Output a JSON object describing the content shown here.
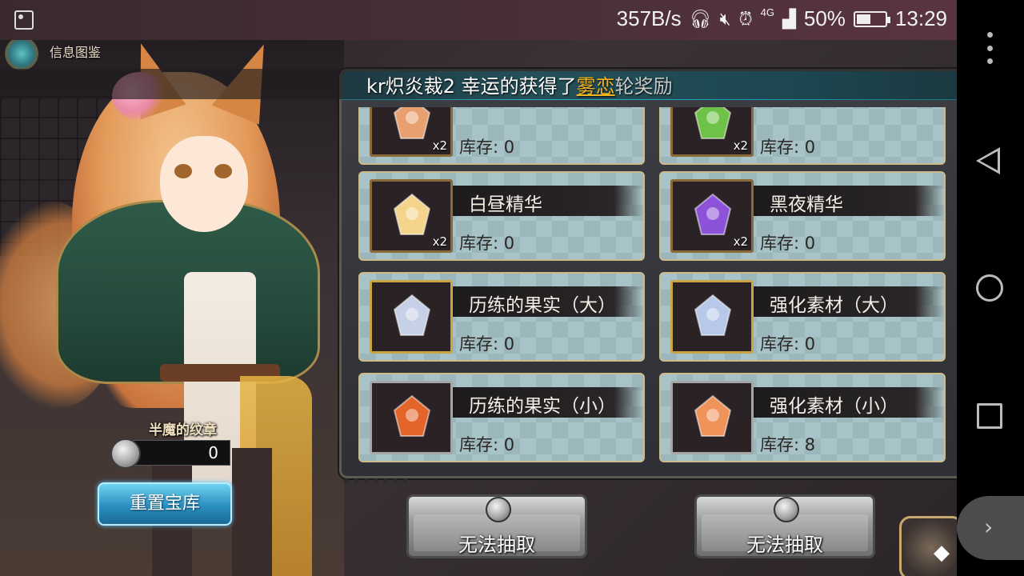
{
  "status_bar": {
    "speed": "357B/s",
    "network": "4G",
    "battery": "50%",
    "battery_level": 0.5,
    "time": "13:29",
    "icons": [
      "image-icon",
      "headphones-icon",
      "mute-icon",
      "alarm-icon",
      "signal-icon",
      "battery-icon"
    ]
  },
  "game": {
    "info_tab": "信息图鉴",
    "ticker": {
      "prefix": "kr炽炎裁2 幸运的获得了",
      "highlight": "雾恋",
      "suffix": "轮奖励"
    },
    "items": [
      {
        "name": "",
        "stock": "库存: 0",
        "multiplier": "x2",
        "icon": "orange-crystal-icon",
        "color": "#e8a070",
        "frame": "bronze"
      },
      {
        "name": "",
        "stock": "库存: 0",
        "multiplier": "x2",
        "icon": "green-thorn-icon",
        "color": "#6ec248",
        "frame": "bronze"
      },
      {
        "name": "白昼精华",
        "stock": "库存: 0",
        "multiplier": "x2",
        "icon": "day-essence-icon",
        "color": "#f3d48a",
        "frame": "bronze"
      },
      {
        "name": "黑夜精华",
        "stock": "库存: 0",
        "multiplier": "x2",
        "icon": "night-essence-icon",
        "color": "#8c52d8",
        "frame": "bronze"
      },
      {
        "name": "历练的果实（大）",
        "stock": "库存: 0",
        "multiplier": "",
        "icon": "silver-fruit-icon",
        "color": "#c6d0e6",
        "frame": "gold"
      },
      {
        "name": "强化素材（大）",
        "stock": "库存: 0",
        "multiplier": "",
        "icon": "blue-crystal-icon",
        "color": "#b8c8e8",
        "frame": "gold"
      },
      {
        "name": "历练的果实（小）",
        "stock": "库存: 0",
        "multiplier": "",
        "icon": "orange-fruit-icon",
        "color": "#e4652a",
        "frame": "silver"
      },
      {
        "name": "强化素材（小）",
        "stock": "库存: 8",
        "multiplier": "",
        "icon": "orange-crystal-cluster-icon",
        "color": "#f0935a",
        "frame": "silver"
      }
    ],
    "emblem": {
      "label": "半魔的纹章",
      "count": "0"
    },
    "reset_button": "重置宝库",
    "draw_buttons": [
      "无法抽取",
      "无法抽取"
    ]
  }
}
